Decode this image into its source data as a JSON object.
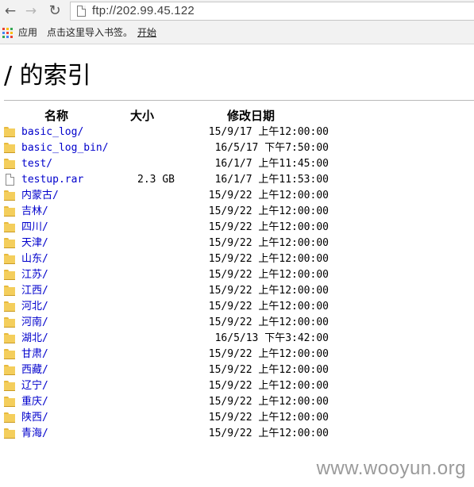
{
  "browser": {
    "url": "ftp://202.99.45.122",
    "bookmarks": {
      "apps": "应用",
      "import": "点击这里导入书签。",
      "start": "开始"
    }
  },
  "page": {
    "heading": "/ 的索引",
    "columns": {
      "name": "名称",
      "size": "大小",
      "modified": "修改日期"
    },
    "entries": [
      {
        "type": "folder",
        "name": "basic_log/",
        "size": "",
        "modified": "15/9/17 上午12:00:00"
      },
      {
        "type": "folder",
        "name": "basic_log_bin/",
        "size": "",
        "modified": "16/5/17 下午7:50:00"
      },
      {
        "type": "folder",
        "name": "test/",
        "size": "",
        "modified": "16/1/7 上午11:45:00"
      },
      {
        "type": "file",
        "name": "testup.rar",
        "size": "2.3 GB",
        "modified": "16/1/7 上午11:53:00"
      },
      {
        "type": "folder",
        "name": "内蒙古/",
        "size": "",
        "modified": "15/9/22 上午12:00:00"
      },
      {
        "type": "folder",
        "name": "吉林/",
        "size": "",
        "modified": "15/9/22 上午12:00:00"
      },
      {
        "type": "folder",
        "name": "四川/",
        "size": "",
        "modified": "15/9/22 上午12:00:00"
      },
      {
        "type": "folder",
        "name": "天津/",
        "size": "",
        "modified": "15/9/22 上午12:00:00"
      },
      {
        "type": "folder",
        "name": "山东/",
        "size": "",
        "modified": "15/9/22 上午12:00:00"
      },
      {
        "type": "folder",
        "name": "江苏/",
        "size": "",
        "modified": "15/9/22 上午12:00:00"
      },
      {
        "type": "folder",
        "name": "江西/",
        "size": "",
        "modified": "15/9/22 上午12:00:00"
      },
      {
        "type": "folder",
        "name": "河北/",
        "size": "",
        "modified": "15/9/22 上午12:00:00"
      },
      {
        "type": "folder",
        "name": "河南/",
        "size": "",
        "modified": "15/9/22 上午12:00:00"
      },
      {
        "type": "folder",
        "name": "湖北/",
        "size": "",
        "modified": "16/5/13 下午3:42:00"
      },
      {
        "type": "folder",
        "name": "甘肃/",
        "size": "",
        "modified": "15/9/22 上午12:00:00"
      },
      {
        "type": "folder",
        "name": "西藏/",
        "size": "",
        "modified": "15/9/22 上午12:00:00"
      },
      {
        "type": "folder",
        "name": "辽宁/",
        "size": "",
        "modified": "15/9/22 上午12:00:00"
      },
      {
        "type": "folder",
        "name": "重庆/",
        "size": "",
        "modified": "15/9/22 上午12:00:00"
      },
      {
        "type": "folder",
        "name": "陕西/",
        "size": "",
        "modified": "15/9/22 上午12:00:00"
      },
      {
        "type": "folder",
        "name": "青海/",
        "size": "",
        "modified": "15/9/22 上午12:00:00"
      }
    ]
  },
  "watermark": "www.wooyun.org",
  "colors": {
    "link": "#0000cc",
    "folder": "#f4ce5c",
    "rule": "#b8b8b8",
    "watermark": "#9a9a9a"
  }
}
